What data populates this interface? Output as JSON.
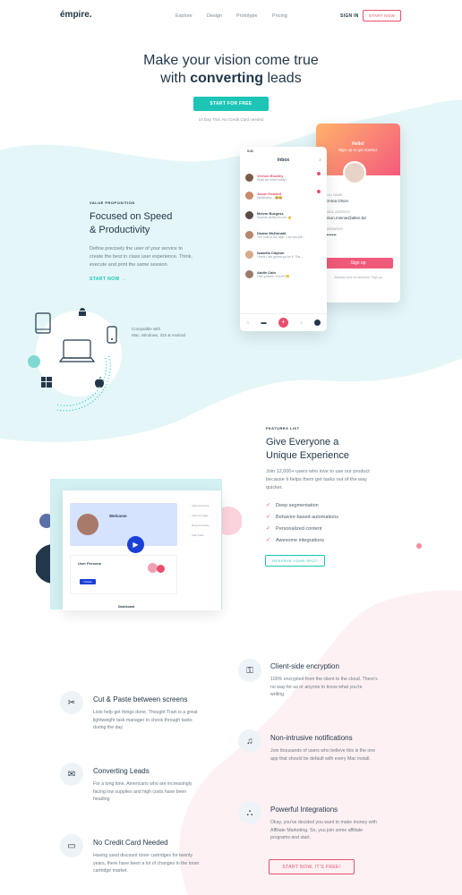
{
  "nav": {
    "logo": "émpire.",
    "links": [
      "Explore",
      "Design",
      "Prototype",
      "Pricing"
    ],
    "sign_in": "SIGN IN",
    "start_now": "START NOW"
  },
  "hero": {
    "line1": "Make your vision come true",
    "line2_pre": "with ",
    "line2_bold": "converting",
    "line2_post": " leads",
    "cta": "START FOR FREE",
    "trial": "14 Day Trial. No Credit Card needed"
  },
  "value": {
    "eyebrow": "VALUE PROPOSITION",
    "title_l1": "Focused on Speed",
    "title_l2": "& Productivity",
    "body": "Define precisely the user of your service to create the best in class user experience. Think, execute and print the same session.",
    "link": "START NOW →",
    "compat_l1": "Compatible with",
    "compat_l2": "Mac, Windows, iOS & Android"
  },
  "phone_inbox": {
    "time": "9:41",
    "title": "Inbox",
    "rows": [
      {
        "name": "Vernon Bradley",
        "text": "Shall we meet today?",
        "unread": true
      },
      {
        "name": "Jason Howard",
        "text": "Hahahaha... 😂😂",
        "unread": true
      },
      {
        "name": "Melvin Burgess",
        "text": "Sounds perfect to me 👍",
        "unread": false
      },
      {
        "name": "Duane McDonald",
        "text": "The cost is too high. Can you ple...",
        "unread": false
      },
      {
        "name": "Isabella Clayton",
        "text": "I think I am gonna go for it. Tha...",
        "unread": false
      },
      {
        "name": "Addie Cain",
        "text": "Ohh yeaahh YOU!!!! 😁",
        "unread": false
      }
    ]
  },
  "phone_signup": {
    "greeting": "Hello!",
    "subtitle": "Sign up to get started.",
    "name_label": "FULL NAME",
    "name_value": "Emma Olson",
    "email_label": "EMAIL ADDRESS",
    "email_value": "olson.minnie@allen.biz",
    "password_label": "PASSWORD",
    "password_value": "••••••••",
    "button": "Sign up",
    "footer": "Already have an account? Sign up"
  },
  "features_list": {
    "eyebrow": "FEATURES LIST",
    "title_l1": "Give Everyone a",
    "title_l2": "Unique Experience",
    "body": "Join 12,000+ users who love to use our product because it helps them get tasks out of the way quicker.",
    "items": [
      "Deep segmentation",
      "Behavior-based automations",
      "Personalized content",
      "Awesome integrations"
    ],
    "cta": "RESERVE YOUR SPOT"
  },
  "dashboard": {
    "welcome": "Welcome",
    "persona": "User Persona",
    "btn": "Create",
    "side": [
      "Add document",
      "Add an Image",
      "Recent Activity",
      "Add Video"
    ],
    "bottom": "Dashboard"
  },
  "features": {
    "left": [
      {
        "icon": "scissors-icon",
        "glyph": "✂",
        "title": "Cut & Paste between screens",
        "body": "Lists help get things done, Thought Train is a great lightweight task manager to check through tasks during the day."
      },
      {
        "icon": "envelope-icon",
        "glyph": "✉",
        "title": "Converting Leads",
        "body": "For a long time, Americans who are increasingly facing low supplies and high costs have been heading"
      },
      {
        "icon": "credit-card-icon",
        "glyph": "▭",
        "title": "No Credit Card Needed",
        "body": "Having used discount toner cartridges for twenty years, there have been a lot of changes in the toner cartridge market."
      }
    ],
    "right": [
      {
        "icon": "lock-icon",
        "glyph": "⚿",
        "title": "Client-side encryption",
        "body": "100% encrypted from the client to the cloud. There's no way for us or anyone to know what you're writing."
      },
      {
        "icon": "bell-icon",
        "glyph": "♫",
        "title": "Non-intrusive notifications",
        "body": "Join thousands of users who believe this is the one app that should be default with every Mac install."
      },
      {
        "icon": "network-icon",
        "glyph": "⛬",
        "title": "Powerful Integrations",
        "body": "Okay, you've decided you want to make money with Affiliate Marketing. So, you join some affiliate programs and start."
      }
    ],
    "cta": "START NOW, IT'S FREE!"
  },
  "colors": {
    "teal": "#1cc5b6",
    "pink": "#e94f6d",
    "navy": "#22384a"
  }
}
